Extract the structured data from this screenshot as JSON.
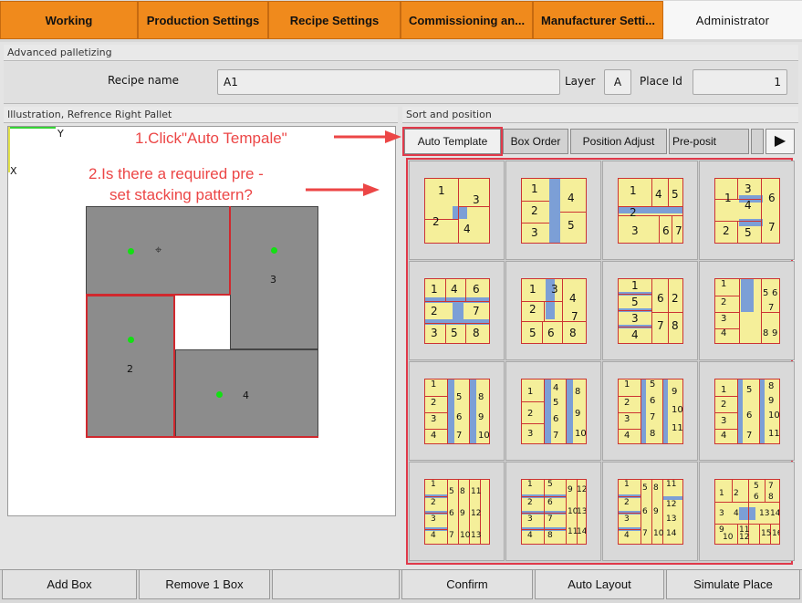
{
  "tabs": [
    {
      "label": "Working"
    },
    {
      "label": "Production Settings"
    },
    {
      "label": "Recipe Settings"
    },
    {
      "label": "Commissioning an..."
    },
    {
      "label": "Manufacturer Setti..."
    },
    {
      "label": "Administrator"
    }
  ],
  "advanced": {
    "title": "Advanced palletizing",
    "recipe_name_label": "Recipe name",
    "recipe_name_value": "A1",
    "layer_label": "Layer",
    "layer_value": "A",
    "place_id_label": "Place Id",
    "place_id_value": "1"
  },
  "illustration": {
    "title": "Illustration, Refrence Right Pallet",
    "axis_y": "Y",
    "axis_x": "X",
    "boxes": [
      {
        "label": "2"
      },
      {
        "label": "3"
      },
      {
        "label": "4"
      }
    ]
  },
  "sort": {
    "title": "Sort and position",
    "subtabs": [
      {
        "label": "Auto Template"
      },
      {
        "label": "Box Order"
      },
      {
        "label": "Position Adjust"
      },
      {
        "label": "Pre-posit"
      }
    ],
    "next_arrow": "▶"
  },
  "annotations": {
    "step1": "1.Click\"Auto Tempale\"",
    "step2_line1": "2.Is there a required pre -",
    "step2_line2": "set stacking pattern?"
  },
  "bottom_buttons": {
    "add_box": "Add Box",
    "remove_box": "Remove 1 Box",
    "confirm": "Confirm",
    "auto_layout": "Auto Layout",
    "simulate_place": "Simulate Place"
  },
  "colors": {
    "tab_orange": "#f08a1c",
    "annotation_red": "#ec4646",
    "highlight_red": "#e0394a",
    "pattern_yellow": "#f5ef9a",
    "pattern_blue": "#7c9fd6",
    "center_dot_green": "#12e012"
  },
  "templates": [
    {
      "labels": [
        "1",
        "3",
        "2",
        "4"
      ]
    },
    {
      "labels": [
        "1",
        "4",
        "2",
        "3",
        "5"
      ]
    },
    {
      "labels": [
        "1",
        "4",
        "5",
        "2",
        "3",
        "6",
        "7"
      ]
    },
    {
      "labels": [
        "1",
        "3",
        "6",
        "4",
        "2",
        "5",
        "7"
      ]
    },
    {
      "labels": [
        "1",
        "4",
        "6",
        "2",
        "7",
        "3",
        "5",
        "8"
      ]
    },
    {
      "labels": [
        "1",
        "3",
        "4",
        "2",
        "7",
        "5",
        "6",
        "8"
      ]
    },
    {
      "labels": [
        "1",
        "5",
        "6",
        "2",
        "3",
        "7",
        "8",
        "4"
      ]
    },
    {
      "labels": [
        "1",
        "5",
        "6",
        "2",
        "7",
        "3",
        "4",
        "8",
        "9"
      ]
    },
    {
      "labels": [
        "1",
        "5",
        "8",
        "2",
        "6",
        "9",
        "3",
        "4",
        "7",
        "10"
      ]
    },
    {
      "labels": [
        "1",
        "4",
        "8",
        "5",
        "2",
        "9",
        "6",
        "3",
        "7",
        "10"
      ]
    },
    {
      "labels": [
        "1",
        "5",
        "9",
        "2",
        "6",
        "10",
        "3",
        "7",
        "4",
        "8",
        "11"
      ]
    },
    {
      "labels": [
        "1",
        "5",
        "8",
        "2",
        "9",
        "6",
        "3",
        "10",
        "4",
        "7",
        "11"
      ]
    },
    {
      "labels": [
        "1",
        "5",
        "8",
        "11",
        "2",
        "6",
        "9",
        "12",
        "3",
        "4",
        "7",
        "10",
        "13"
      ]
    },
    {
      "labels": [
        "1",
        "5",
        "9",
        "12",
        "2",
        "6",
        "10",
        "13",
        "3",
        "7",
        "4",
        "8",
        "11",
        "14"
      ]
    },
    {
      "labels": [
        "1",
        "5",
        "8",
        "11",
        "2",
        "12",
        "6",
        "9",
        "3",
        "13",
        "4",
        "7",
        "10",
        "14"
      ]
    },
    {
      "labels": [
        "1",
        "2",
        "5",
        "7",
        "6",
        "8",
        "3",
        "4",
        "13",
        "14",
        "9",
        "11",
        "10",
        "12",
        "15",
        "16"
      ]
    }
  ]
}
